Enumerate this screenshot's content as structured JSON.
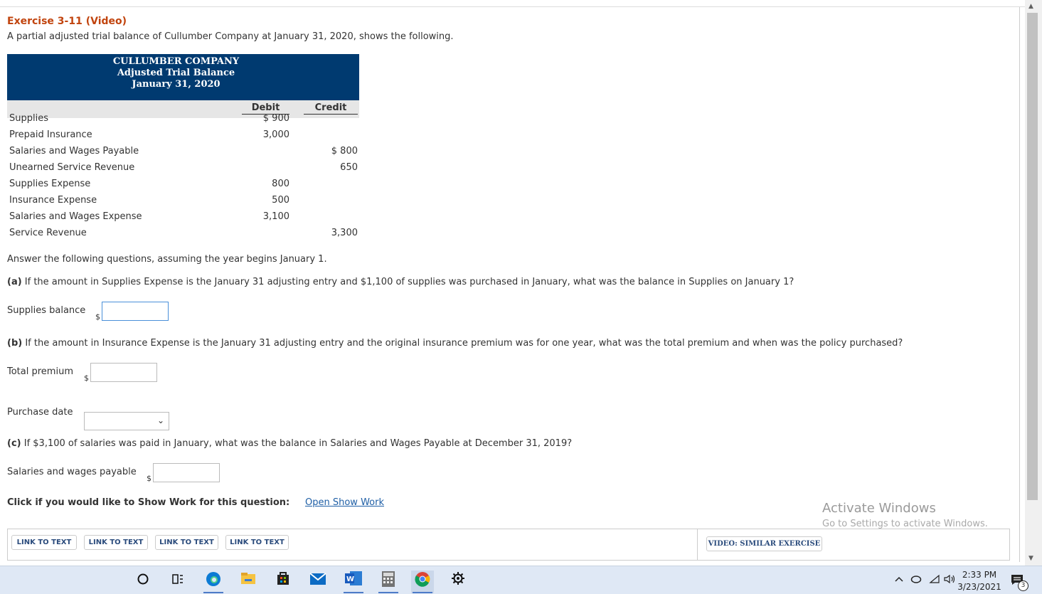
{
  "exercise": {
    "title": "Exercise 3-11 (Video)",
    "intro": "A partial adjusted trial balance of Cullumber Company at January 31, 2020, shows the following."
  },
  "trial_balance": {
    "company": "CULLUMBER COMPANY",
    "statement": "Adjusted Trial Balance",
    "date": "January 31, 2020",
    "debit_header": "Debit",
    "credit_header": "Credit",
    "rows": [
      {
        "account": "Supplies",
        "debit": "$ 900",
        "credit": ""
      },
      {
        "account": "Prepaid Insurance",
        "debit": "3,000",
        "credit": ""
      },
      {
        "account": "Salaries and Wages Payable",
        "debit": "",
        "credit": "$ 800"
      },
      {
        "account": "Unearned Service Revenue",
        "debit": "",
        "credit": "650"
      },
      {
        "account": "Supplies Expense",
        "debit": "800",
        "credit": ""
      },
      {
        "account": "Insurance Expense",
        "debit": "500",
        "credit": ""
      },
      {
        "account": "Salaries and Wages Expense",
        "debit": "3,100",
        "credit": ""
      },
      {
        "account": "Service Revenue",
        "debit": "",
        "credit": "3,300"
      }
    ]
  },
  "instructions": "Answer the following questions, assuming the year begins January 1.",
  "questions": {
    "a_label": "(a)",
    "a_text": "If the amount in Supplies Expense is the January 31 adjusting entry and $1,100 of supplies was purchased in January, what was the balance in Supplies on January 1?",
    "a_field_label": "Supplies balance",
    "b_label": "(b)",
    "b_text": "If the amount in Insurance Expense is the January 31 adjusting entry and the original insurance premium was for one year, what was the total premium and when was the policy purchased?",
    "b_field1_label": "Total premium",
    "b_field2_label": "Purchase date",
    "c_label": "(c)",
    "c_text": "If $3,100 of salaries was paid in January, what was the balance in Salaries and Wages Payable at December 31, 2019?",
    "c_field_label": "Salaries and wages payable",
    "currency": "$"
  },
  "show_work": {
    "prompt": "Click if you would like to Show Work for this question:",
    "link": "Open Show Work"
  },
  "watermark": {
    "line1": "Activate Windows",
    "line2": "Go to Settings to activate Windows."
  },
  "bottom_buttons": {
    "link_to_text": [
      "LINK TO TEXT",
      "LINK TO TEXT",
      "LINK TO TEXT",
      "LINK TO TEXT"
    ],
    "video": "VIDEO: SIMILAR EXERCISE"
  },
  "taskbar": {
    "icons": [
      "search-circle-icon",
      "task-view-icon",
      "edge-icon",
      "file-explorer-icon",
      "store-icon",
      "mail-icon",
      "word-icon",
      "calculator-icon",
      "chrome-icon",
      "settings-icon"
    ],
    "time": "2:33 PM",
    "date": "3/23/2021",
    "notification_count": "3"
  }
}
